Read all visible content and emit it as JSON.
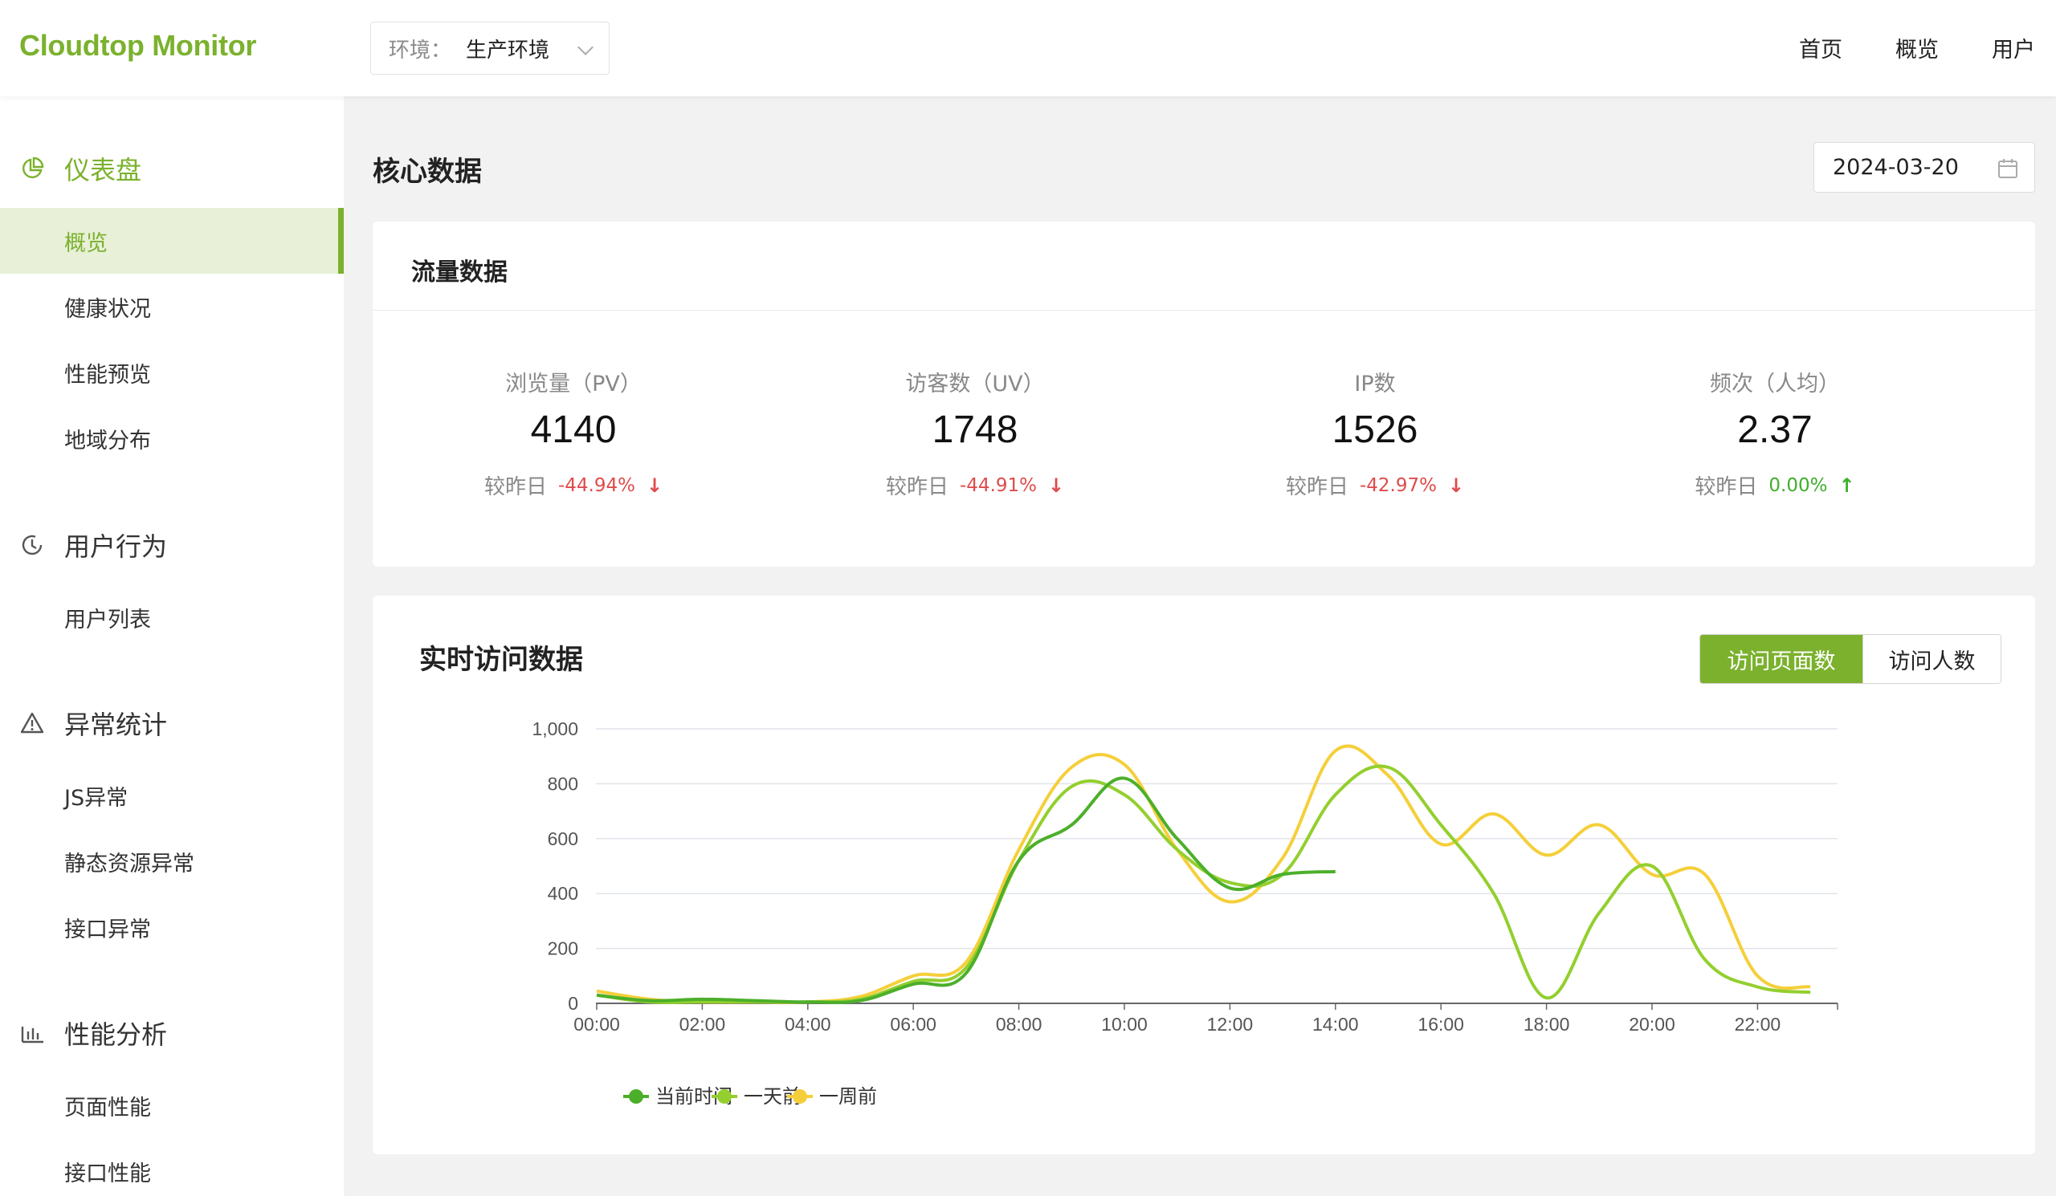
{
  "header": {
    "logo": "Cloudtop Monitor",
    "env_label": "环境：",
    "env_value": "生产环境",
    "nav": [
      "首页",
      "概览",
      "用户"
    ]
  },
  "sidebar": {
    "groups": [
      {
        "title": "仪表盘",
        "icon": "pie-chart-icon",
        "items": [
          "概览",
          "健康状况",
          "性能预览",
          "地域分布"
        ]
      },
      {
        "title": "用户行为",
        "icon": "clock-icon",
        "items": [
          "用户列表"
        ]
      },
      {
        "title": "异常统计",
        "icon": "warning-icon",
        "items": [
          "JS异常",
          "静态资源异常",
          "接口异常"
        ]
      },
      {
        "title": "性能分析",
        "icon": "bar-chart-icon",
        "items": [
          "页面性能",
          "接口性能"
        ]
      }
    ],
    "active_item": "概览"
  },
  "main": {
    "title": "核心数据",
    "date": "2024-03-20",
    "traffic": {
      "title": "流量数据",
      "compare_label": "较昨日",
      "stats": [
        {
          "label": "浏览量（PV）",
          "value": "4140",
          "change": "-44.94%",
          "trend": "down"
        },
        {
          "label": "访客数（UV）",
          "value": "1748",
          "change": "-44.91%",
          "trend": "down"
        },
        {
          "label": "IP数",
          "value": "1526",
          "change": "-42.97%",
          "trend": "down"
        },
        {
          "label": "频次（人均）",
          "value": "2.37",
          "change": "0.00%",
          "trend": "up"
        }
      ]
    },
    "realtime": {
      "title": "实时访问数据",
      "toggle": [
        "访问页面数",
        "访问人数"
      ],
      "toggle_active": "访问页面数"
    }
  },
  "chart_data": {
    "type": "line",
    "title": "",
    "xlabel": "",
    "ylabel": "",
    "x": [
      "00:00",
      "01:00",
      "02:00",
      "03:00",
      "04:00",
      "05:00",
      "06:00",
      "07:00",
      "08:00",
      "09:00",
      "10:00",
      "11:00",
      "12:00",
      "13:00",
      "14:00",
      "15:00",
      "16:00",
      "17:00",
      "18:00",
      "19:00",
      "20:00",
      "21:00",
      "22:00",
      "23:00"
    ],
    "x_tick_labels": [
      "00:00",
      "02:00",
      "04:00",
      "06:00",
      "08:00",
      "10:00",
      "12:00",
      "14:00",
      "16:00",
      "18:00",
      "20:00",
      "22:00"
    ],
    "ylim": [
      0,
      1000
    ],
    "y_ticks": [
      "0",
      "200",
      "400",
      "600",
      "800",
      "1,000"
    ],
    "grid": true,
    "legend_position": "bottom",
    "series": [
      {
        "name": "当前时间",
        "color": "#4caf2a",
        "values": [
          30,
          10,
          15,
          10,
          5,
          10,
          70,
          110,
          520,
          650,
          820,
          600,
          420,
          470,
          480
        ]
      },
      {
        "name": "一天前",
        "color": "#93cf2e",
        "values": [
          30,
          5,
          5,
          5,
          5,
          15,
          80,
          130,
          520,
          790,
          760,
          560,
          440,
          470,
          760,
          860,
          650,
          400,
          20,
          330,
          500,
          160,
          60,
          40
        ]
      },
      {
        "name": "一周前",
        "color": "#f5cf3a",
        "values": [
          45,
          15,
          5,
          5,
          5,
          25,
          100,
          150,
          560,
          860,
          870,
          560,
          370,
          530,
          920,
          830,
          580,
          690,
          540,
          650,
          470,
          470,
          100,
          60
        ]
      }
    ]
  }
}
